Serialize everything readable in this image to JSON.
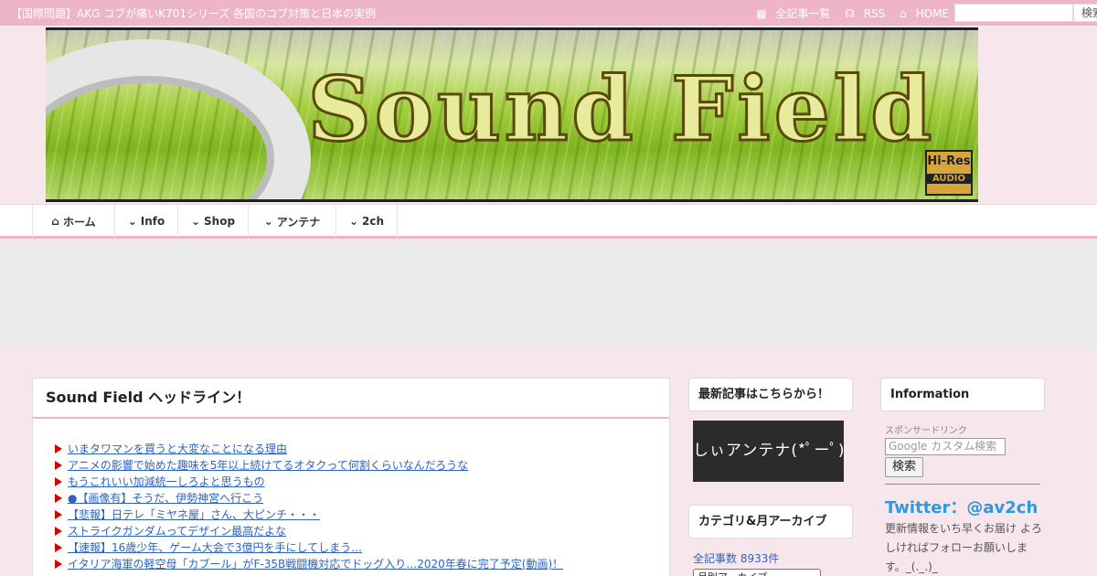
{
  "topbar": {
    "ticker": "【国際問題】AKG コブが痛いK701シリーズ 各国のコブ対策と日本の実例",
    "links": [
      {
        "icon": "grid-icon",
        "glyph": "▦",
        "label": "全記事一覧"
      },
      {
        "icon": "rss-icon",
        "glyph": "☊",
        "label": "RSS"
      },
      {
        "icon": "home-icon",
        "glyph": "⌂",
        "label": "HOME"
      }
    ],
    "search_button": "検索"
  },
  "banner": {
    "title": "Sound Field",
    "badge_line1": "Hi-Res",
    "badge_line2": "AUDIO"
  },
  "nav": [
    {
      "icon": "home-icon",
      "glyph": "⌂",
      "label": "ホーム",
      "width": 90
    },
    {
      "icon": "chevron-down-icon",
      "glyph": "⌄",
      "label": "Info",
      "width": 69
    },
    {
      "icon": "chevron-down-icon",
      "glyph": "⌄",
      "label": "Shop",
      "width": 77
    },
    {
      "icon": "chevron-down-icon",
      "glyph": "⌄",
      "label": "アンテナ",
      "width": 96
    },
    {
      "icon": "chevron-down-icon",
      "glyph": "⌄",
      "label": "2ch",
      "width": 68
    }
  ],
  "headlines": {
    "title": "Sound Field ヘッドライン！",
    "items": [
      "いまタワマンを買うと大変なことになる理由",
      "アニメの影響で始めた趣味を5年以上続けてるオタクって何割くらいなんだろうな",
      "もうこれいい加減統一しろよと思うもの",
      "●【画像有】そうだ、伊勢神宮へ行こう",
      "【悲報】日テレ「ミヤネ屋」さん、大ピンチ・・・",
      "ストライクガンダムってデザイン最高だよな",
      "【速報】16歳少年、ゲーム大会で3億円を手にしてしまう…",
      "イタリア海軍の軽空母「カブール」がF-35B戦闘機対応でドッグ入り…2020年春に完了予定(動画)！"
    ]
  },
  "middle": {
    "latest_title": "最新記事はこちらから！",
    "antenna_label": "しぃアンテナ(*ﾟーﾟ)",
    "category_title": "カテゴリ&月アーカイブ",
    "article_count": "全記事数 8933件",
    "archive_select": "月別アーカイブ"
  },
  "right": {
    "info_title": "Information",
    "sponsor": "スポンサードリンク",
    "search_placeholder": "Google カスタム検索",
    "search_button": "検索",
    "twitter": "Twitter：@av2ch",
    "twitter_text": "更新情報をいち早くお届け よろしければフォローお願いします。_(._.)_"
  },
  "colors": {
    "accent_pink": "#eeb4c7",
    "background": "#f7e6ec",
    "link": "#2d63c0",
    "twitter": "#2a9ae2"
  }
}
